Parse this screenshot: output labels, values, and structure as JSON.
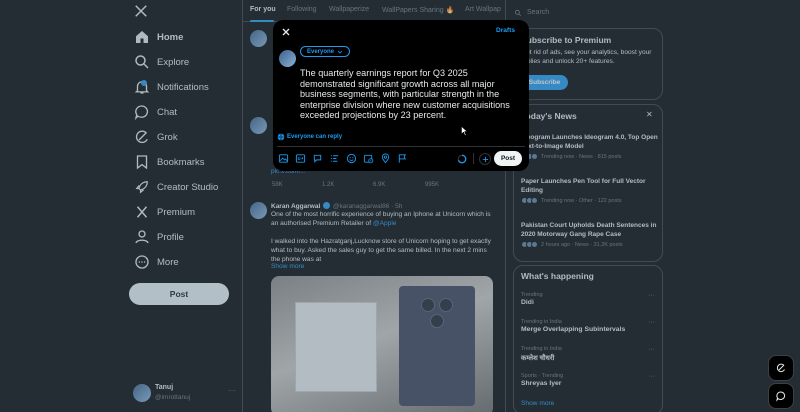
{
  "colors": {
    "accent": "#1d9bf0",
    "background": "#000000",
    "text": "#e7e9ea",
    "muted": "#71767b",
    "border": "#2f3336"
  },
  "sidebar": {
    "items": [
      {
        "label": "Home",
        "icon": "home-icon"
      },
      {
        "label": "Explore",
        "icon": "search-icon"
      },
      {
        "label": "Notifications",
        "icon": "bell-icon"
      },
      {
        "label": "Chat",
        "icon": "chat-icon"
      },
      {
        "label": "Grok",
        "icon": "grok-icon"
      },
      {
        "label": "Bookmarks",
        "icon": "bookmark-icon"
      },
      {
        "label": "Creator Studio",
        "icon": "rocket-icon"
      },
      {
        "label": "Premium",
        "icon": "x-logo-icon"
      },
      {
        "label": "Profile",
        "icon": "person-icon"
      },
      {
        "label": "More",
        "icon": "more-circle-icon"
      }
    ],
    "post_label": "Post",
    "profile": {
      "name": "Tanuj",
      "handle": "@imrottanuj",
      "menu": "···"
    }
  },
  "tabs": [
    "For you",
    "Following",
    "Wallpaperize",
    "WallPapers Sharing 🔥",
    "Art Wallpap"
  ],
  "search": {
    "placeholder": "Search"
  },
  "feed": {
    "link_fragment": "pic.x.com/...",
    "metrics": {
      "replies": "58K",
      "reposts": "1.2K",
      "likes": "6.9K",
      "views": "995K"
    },
    "tweet": {
      "name": "Karan Aggarwal",
      "handle": "@karanaggarwal86 · 5h",
      "line1": "One of the most horrific experience of buying an Iphone at Unicorn which is an authorised Premium Retailer of ",
      "mention": "@Apple",
      "line2": "I walked into the Hazratganj,Lucknow store of Unicorn hoping to get exactly what to buy. Asked the sales guy to get the same billed. In the next 2 mins the phone was at",
      "show_more": "Show more"
    }
  },
  "right": {
    "subscribe": {
      "title": "Subscribe to Premium",
      "text": "Get rid of ads, see your analytics, boost your replies and unlock 20+ features.",
      "button": "Subscribe"
    },
    "news": {
      "title": "Today's News",
      "items": [
        {
          "headline": "Ideogram Launches Ideogram 4.0, Top Open Text-to-Image Model",
          "meta": "Trending now · News · 815 posts"
        },
        {
          "headline": "Paper Launches Pen Tool for Full Vector Editing",
          "meta": "Trending now · Other · 122 posts"
        },
        {
          "headline": "Pakistan Court Upholds Death Sentences in 2020 Motorway Gang Rape Case",
          "meta": "2 hours ago · News · 31.2K posts"
        }
      ]
    },
    "happening": {
      "title": "What's happening",
      "items": [
        {
          "category": "Trending",
          "topic": "Didi"
        },
        {
          "category": "Trending in India",
          "topic": "Merge Overlapping Subintervals"
        },
        {
          "category": "Trending in India",
          "topic": "कम्लेश चौधरी"
        },
        {
          "category": "Sports · Trending",
          "topic": "Shreyas Iyer"
        }
      ],
      "show_more": "Show more"
    }
  },
  "composer": {
    "drafts": "Drafts",
    "audience": "Everyone",
    "text": "The quarterly earnings report for Q3 2025 demonstrated significant growth across all major business segments, with particular strength in the enterprise division where new customer acquisitions exceeded projections by 23 percent.",
    "reply_setting": "Everyone can reply",
    "post": "Post",
    "tools": [
      "image-icon",
      "gif-icon",
      "grok-compose-icon",
      "poll-icon",
      "emoji-icon",
      "schedule-icon",
      "location-icon",
      "flag-icon"
    ]
  }
}
